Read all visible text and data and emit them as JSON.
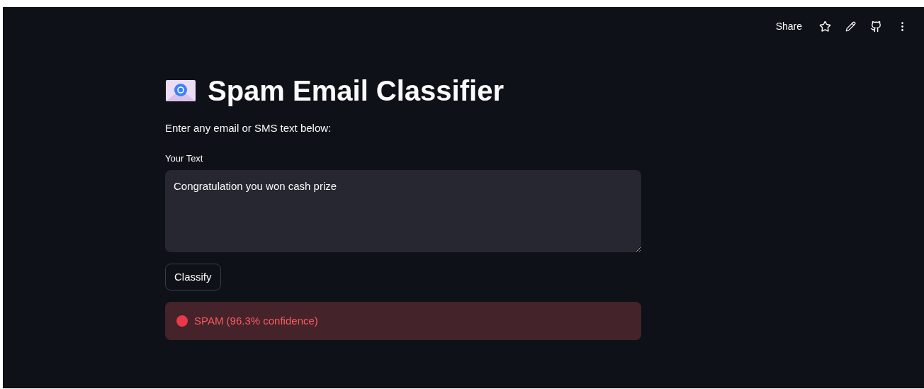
{
  "header": {
    "share": "Share"
  },
  "title": "Spam Email Classifier",
  "subtitle": "Enter any email or SMS text below:",
  "text_area": {
    "label": "Your Text",
    "value": "Congratulation you won cash prize"
  },
  "button": "Classify",
  "result": {
    "kind": "error",
    "text": "SPAM (96.3% confidence)"
  }
}
